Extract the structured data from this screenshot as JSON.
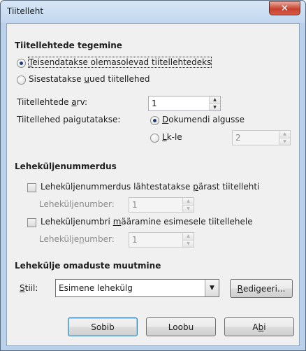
{
  "window": {
    "title": "Tiitelleht",
    "close_glyph": "✕"
  },
  "section_create": {
    "title": "Tiitellehtede tegemine",
    "radio_convert": {
      "pre": "",
      "mn": "T",
      "post": "eisendatakse olemasolevad tiitellehtedeks",
      "checked": true
    },
    "radio_insert": {
      "pre": "Sisestatakse ",
      "mn": "u",
      "post": "ued tiitellehed",
      "checked": false
    },
    "count_label": {
      "pre": "Tiitellehtede ",
      "mn": "a",
      "post": "rv:"
    },
    "count_value": "1",
    "place_label": "Tiitellehed paigutatakse:",
    "radio_doc_start": {
      "pre": "",
      "mn": "D",
      "post": "okumendi algusse",
      "checked": true
    },
    "radio_page": {
      "pre": "",
      "mn": "L",
      "post": "k-le",
      "checked": false
    },
    "page_value": "2"
  },
  "section_numbering": {
    "title": "Leheküljenummerdus",
    "restart_check": {
      "pre": "Leheküljenummerdus lähtestatakse ",
      "mn": "p",
      "post": "ärast tiitellehti",
      "checked": false
    },
    "page_number_label_1": "Leheküljenumber:",
    "page_number_value_1": "1",
    "first_page_check": {
      "pre": "Leheküljenumbri ",
      "mn": "m",
      "post": "ääramine esimesele tiitellehele",
      "checked": false
    },
    "page_number_label_2": {
      "pre": "Lehekülje",
      "mn": "n",
      "post": "umber:"
    },
    "page_number_value_2": "1"
  },
  "section_style": {
    "title": "Lehekülje omaduste muutmine",
    "style_label": {
      "pre": "",
      "mn": "S",
      "post": "tiil:"
    },
    "style_value": "Esimene lehekülg",
    "edit_button": {
      "pre": "",
      "mn": "R",
      "post": "edigeeri..."
    }
  },
  "buttons": {
    "ok": "Sobib",
    "cancel": "Loobu",
    "help": {
      "pre": "A",
      "mn": "b",
      "post": "i"
    }
  }
}
